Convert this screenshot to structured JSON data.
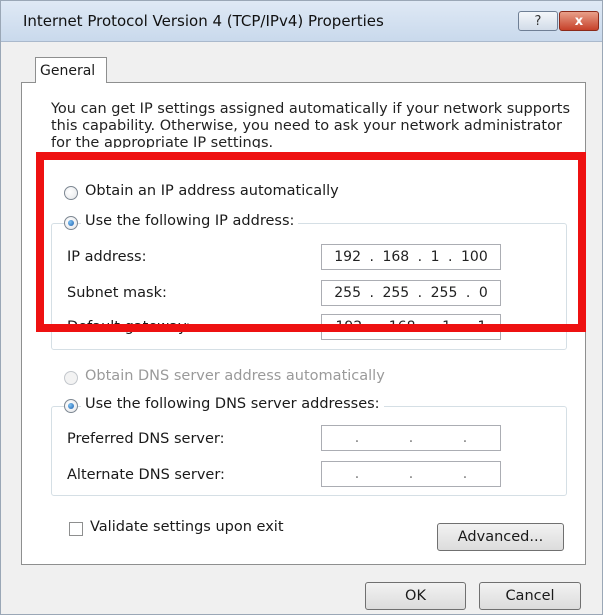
{
  "window": {
    "title": "Internet Protocol Version 4 (TCP/IPv4) Properties",
    "help_label": "?",
    "close_label": "x"
  },
  "tab": {
    "label": "General"
  },
  "intro_text": "You can get IP settings assigned automatically if your network supports this capability. Otherwise, you need to ask your network administrator for the appropriate IP settings.",
  "ip_section": {
    "auto_label": "Obtain an IP address automatically",
    "manual_label": "Use the following IP address:",
    "ip_address_label": "IP address:",
    "ip_address": [
      "192",
      "168",
      "1",
      "100"
    ],
    "subnet_label": "Subnet mask:",
    "subnet_mask": [
      "255",
      "255",
      "255",
      "0"
    ],
    "gateway_label": "Default gateway:",
    "gateway": [
      "192",
      "168",
      "1",
      "1"
    ]
  },
  "dns_section": {
    "auto_label": "Obtain DNS server address automatically",
    "manual_label": "Use the following DNS server addresses:",
    "preferred_label": "Preferred DNS server:",
    "alternate_label": "Alternate DNS server:",
    "dot": "."
  },
  "validate_label": "Validate settings upon exit",
  "buttons": {
    "advanced": "Advanced...",
    "ok": "OK",
    "cancel": "Cancel"
  },
  "colors": {
    "highlight": "#ee1111",
    "title_bar": "#c9d9ec",
    "dialog_bg": "#f0f0f0"
  }
}
